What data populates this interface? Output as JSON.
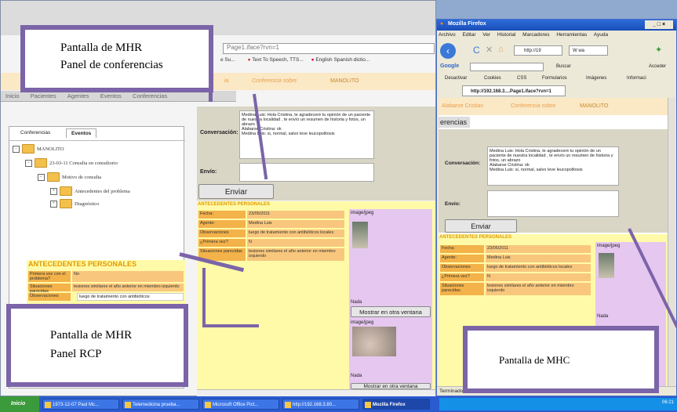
{
  "left_browser": {
    "url_fragment": "Page1.iface?rvn=1",
    "bookmarks": [
      "e Su...",
      "Text To Speech, TTS...",
      "English Spanish dictio..."
    ],
    "header": {
      "name_label": "ia",
      "conference_label": "Conferencia sobre",
      "patient": "MANOLITO"
    },
    "tabs": [
      "Inicio",
      "Pacientes",
      "Agentes",
      "Eventos",
      "Conferencias"
    ],
    "tree": {
      "tab_conferencias": "Conferencias",
      "tab_eventos": "Eventos",
      "items": [
        "MANOLITO",
        "23-03-11 Consulta en consultorio",
        "Motivo de consulta",
        "Antecedentes del problema",
        "Diagnóstico"
      ]
    },
    "antecedentes": {
      "title": "ANTECEDENTES PERSONALES",
      "rows": [
        {
          "label": "Primera vez con el problema?",
          "value": "No"
        },
        {
          "label": "Situaciones parecidas",
          "value": "lesiones similares el año anterior en miembro izquierdo"
        },
        {
          "label": "Observaciones",
          "value": "luego de tratamiento con antibióticos"
        }
      ]
    },
    "conversation": {
      "label": "Conversación:",
      "text": "Medina Luis: Hola Cristina, te agradeceré tu opinión de un paciente de nuestra localidad , te envío un resumen de historia y fotos, un abrazo\nAlabarse Cristina: ok\nMedina Luis: si, normal, salvo leve leucopolitosis",
      "send_label": "Envío:",
      "send_button": "Enviar"
    },
    "rcp": {
      "title": "ANTECEDENTES PERSONALES",
      "rows": [
        {
          "label": "Fecha:",
          "value": "23/05/2011"
        },
        {
          "label": "Agente:",
          "value": "Medina Luis"
        },
        {
          "label": "Observaciones",
          "value": "luego de tratamiento con antibióticos locales"
        },
        {
          "label": "¿Primera vez?",
          "value": "N"
        },
        {
          "label": "Situaciones parecidas",
          "value": "lesiones similares el año anterior en miembro izquierdo"
        }
      ],
      "image_type": "image/jpeg",
      "nada": "Nada",
      "show_other_window": "Mostrar en otra ventana",
      "image_type2": "image/jpeg",
      "nada2": "Nada",
      "show_other_window2": "Mostrar en otra ventana"
    }
  },
  "annotations": {
    "conferencias": "Pantalla de MHR\nPanel de conferencias",
    "rcp": "Pantalla de MHR\nPanel RCP",
    "mhc": "Pantalla de MHC"
  },
  "firefox": {
    "title": "Mozilla Firefox",
    "menu": [
      "Archivo",
      "Editar",
      "Ver",
      "Historial",
      "Marcadores",
      "Herramientas",
      "Ayuda"
    ],
    "url": "http://19",
    "search_engine": "W",
    "search_text": "wa",
    "google_label": "Google",
    "buscar": "Buscar",
    "acceder": "Acceder",
    "devtools": [
      "Desactivar",
      "Cookies",
      "CSS",
      "Formularios",
      "Imágenes",
      "Informaci"
    ],
    "tab_title": "http://192.168.3....Page1.iface?rvn=1",
    "header": {
      "name": "Alabarse Cristian",
      "conference": "Conferencia sobre",
      "patient": "MANOLITO"
    },
    "subtitle": "erencias",
    "conversation_label": "Conversación:",
    "conversation_text": "Medina Luis: Hola Cristina, te agradeceré tu opinión de un paciente de nuestra localidad , te envío un resumen de historia y fotos, un abrazo\nAlabarse Cristina: ok\nMedina Luis: si, normal, salvo leve leucopolitosis",
    "send_label": "Envío:",
    "send_button": "Enviar",
    "antecedentes_title": "ANTECEDENTES PERSONALES",
    "rows": [
      {
        "label": "Fecha:",
        "value": "23/05/2011"
      },
      {
        "label": "Agente:",
        "value": "Medina Luis"
      },
      {
        "label": "Observaciones",
        "value": "luego de tratamiento con antibióticos locales"
      },
      {
        "label": "¿Primera vez?",
        "value": "N"
      },
      {
        "label": "Situaciones parecidas",
        "value": "lesiones similares el año anterior en miembro izquierdo"
      }
    ],
    "image_type": "image/jpeg",
    "nada": "Nada",
    "status": "Terminado"
  },
  "taskbar": {
    "start": "Inicio",
    "items": [
      "1973-12-07 Paul Mc...",
      "Telemedicina prueba...",
      "Microsoft Office Pict...",
      "http://192.168.3.80...",
      "Mozilla Firefox"
    ],
    "clock": "06:21"
  }
}
